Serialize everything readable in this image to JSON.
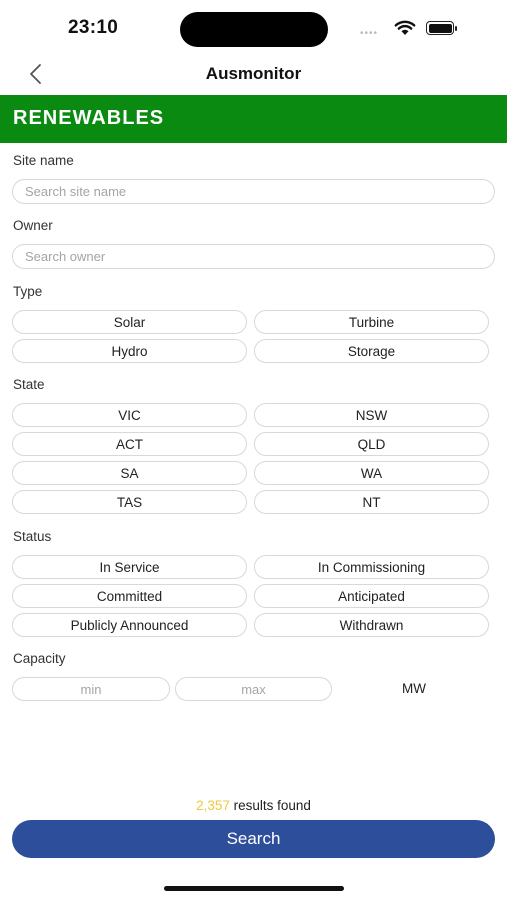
{
  "status_bar": {
    "time": "23:10"
  },
  "nav": {
    "title": "Ausmonitor"
  },
  "banner": {
    "title": "RENEWABLES",
    "color": "#0b8a12"
  },
  "site_name": {
    "label": "Site name",
    "placeholder": "Search site name"
  },
  "owner": {
    "label": "Owner",
    "placeholder": "Search owner"
  },
  "type": {
    "label": "Type",
    "options": [
      "Solar",
      "Turbine",
      "Hydro",
      "Storage"
    ]
  },
  "state": {
    "label": "State",
    "options": [
      "VIC",
      "NSW",
      "ACT",
      "QLD",
      "SA",
      "WA",
      "TAS",
      "NT"
    ]
  },
  "status": {
    "label": "Status",
    "options": [
      "In Service",
      "In Commissioning",
      "Committed",
      "Anticipated",
      "Publicly Announced",
      "Withdrawn"
    ]
  },
  "capacity": {
    "label": "Capacity",
    "min_placeholder": "min",
    "max_placeholder": "max",
    "unit": "MW"
  },
  "results": {
    "count": "2,357",
    "text": "results found"
  },
  "search_button": {
    "label": "Search",
    "color": "#2d4e9a"
  }
}
